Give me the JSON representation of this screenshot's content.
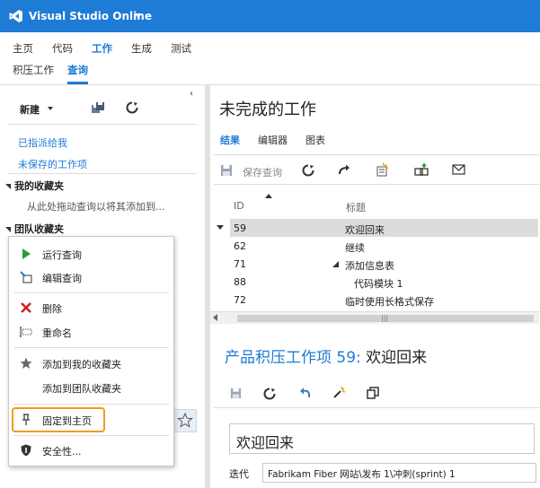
{
  "app": {
    "title": "Visual Studio Online",
    "accent": "#1e7bd6"
  },
  "nav_primary": [
    {
      "label": "主页"
    },
    {
      "label": "代码"
    },
    {
      "label": "工作",
      "active": true
    },
    {
      "label": "生成"
    },
    {
      "label": "测试"
    }
  ],
  "nav_secondary": [
    {
      "label": "积压工作"
    },
    {
      "label": "查询",
      "active": true
    }
  ],
  "left": {
    "new_label": "新建",
    "links": [
      "已指派给我",
      "未保存的工作项"
    ],
    "my_favorites": "我的收藏夹",
    "drag_hint": "从此处拖动查询以将其添加到...",
    "team_favorites": "团队收藏夹"
  },
  "context_menu": {
    "items": [
      {
        "label": "运行查询",
        "icon": "play-icon"
      },
      {
        "label": "编辑查询",
        "icon": "edit-icon"
      },
      {
        "label": "删除",
        "icon": "delete-icon"
      },
      {
        "label": "重命名",
        "icon": "rename-icon"
      },
      {
        "label": "添加到我的收藏夹",
        "icon": "star-icon"
      },
      {
        "label": "添加到团队收藏夹",
        "icon": ""
      },
      {
        "label": "固定到主页",
        "icon": "pin-icon",
        "highlight": "#f09b1e"
      },
      {
        "label": "安全性...",
        "icon": "shield-icon"
      }
    ]
  },
  "right": {
    "title": "未完成的工作",
    "tabs": [
      {
        "label": "结果",
        "active": true
      },
      {
        "label": "编辑器"
      },
      {
        "label": "图表"
      }
    ],
    "save_query": "保存查询",
    "columns": {
      "id": "ID",
      "title": "标题"
    },
    "rows": [
      {
        "id": "59",
        "title": "欢迎回来",
        "selected": true
      },
      {
        "id": "62",
        "title": "继续"
      },
      {
        "id": "71",
        "title": "添加信息表"
      },
      {
        "id": "88",
        "title": "代码模块 1"
      },
      {
        "id": "72",
        "title": "临时使用长格式保存"
      }
    ]
  },
  "form": {
    "prefix": "产品积压工作项 59:",
    "name": "欢迎回来",
    "title_value": "欢迎回来",
    "iteration_label": "迭代",
    "iteration_value": "Fabrikam Fiber 网站\\发布 1\\冲刺(sprint) 1"
  }
}
